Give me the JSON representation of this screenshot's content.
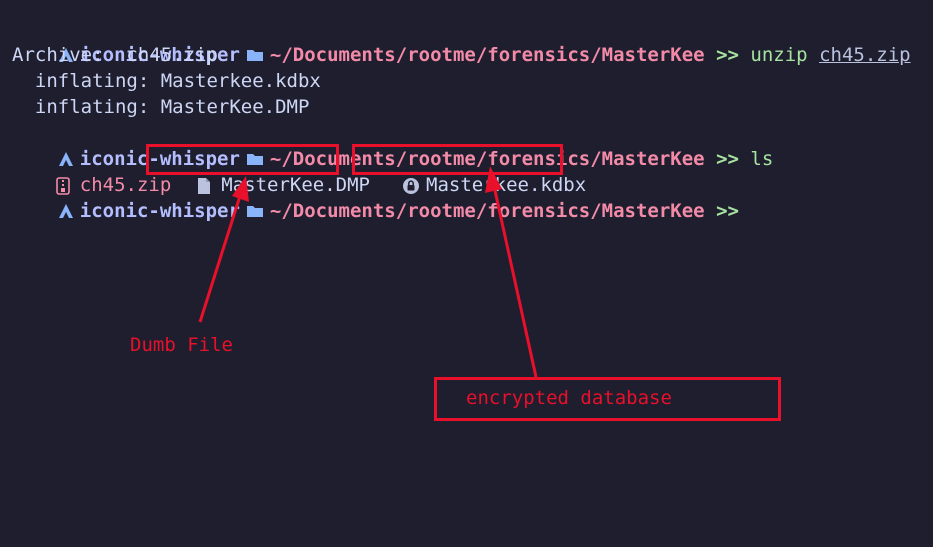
{
  "prompt": {
    "host": "iconic-whisper",
    "path": "~/Documents/rootme/forensics/MasterKee",
    "chevron": ">>"
  },
  "lines": {
    "cmd1": "unzip",
    "cmd1_arg": "ch45.zip",
    "archive": "Archive:  ch45.zip",
    "inflate1": "  inflating: Masterkee.kdbx",
    "inflate2": "  inflating: MasterKee.DMP",
    "cmd2": "ls"
  },
  "ls_output": {
    "zip": "ch45.zip",
    "dmp": "MasterKee.DMP",
    "kdbx": "Masterkee.kdbx"
  },
  "annotations": {
    "dumb_file": "Dumb File",
    "encrypted_db": "encrypted database",
    "color": "#e8102a"
  },
  "colors": {
    "background": "#1e1e2e",
    "host": "#b4befe",
    "path": "#f38ba8",
    "command": "#a6e3a1"
  }
}
